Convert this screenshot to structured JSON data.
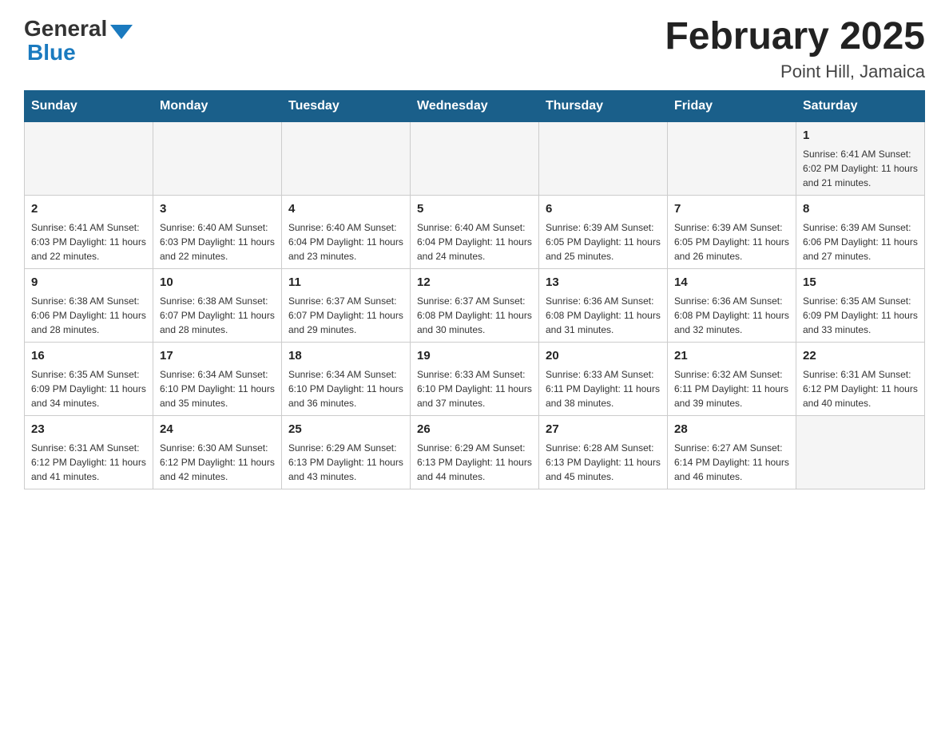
{
  "header": {
    "logo_general": "General",
    "logo_blue": "Blue",
    "month_year": "February 2025",
    "location": "Point Hill, Jamaica"
  },
  "weekdays": [
    "Sunday",
    "Monday",
    "Tuesday",
    "Wednesday",
    "Thursday",
    "Friday",
    "Saturday"
  ],
  "weeks": [
    [
      {
        "day": "",
        "info": ""
      },
      {
        "day": "",
        "info": ""
      },
      {
        "day": "",
        "info": ""
      },
      {
        "day": "",
        "info": ""
      },
      {
        "day": "",
        "info": ""
      },
      {
        "day": "",
        "info": ""
      },
      {
        "day": "1",
        "info": "Sunrise: 6:41 AM\nSunset: 6:02 PM\nDaylight: 11 hours and 21 minutes."
      }
    ],
    [
      {
        "day": "2",
        "info": "Sunrise: 6:41 AM\nSunset: 6:03 PM\nDaylight: 11 hours and 22 minutes."
      },
      {
        "day": "3",
        "info": "Sunrise: 6:40 AM\nSunset: 6:03 PM\nDaylight: 11 hours and 22 minutes."
      },
      {
        "day": "4",
        "info": "Sunrise: 6:40 AM\nSunset: 6:04 PM\nDaylight: 11 hours and 23 minutes."
      },
      {
        "day": "5",
        "info": "Sunrise: 6:40 AM\nSunset: 6:04 PM\nDaylight: 11 hours and 24 minutes."
      },
      {
        "day": "6",
        "info": "Sunrise: 6:39 AM\nSunset: 6:05 PM\nDaylight: 11 hours and 25 minutes."
      },
      {
        "day": "7",
        "info": "Sunrise: 6:39 AM\nSunset: 6:05 PM\nDaylight: 11 hours and 26 minutes."
      },
      {
        "day": "8",
        "info": "Sunrise: 6:39 AM\nSunset: 6:06 PM\nDaylight: 11 hours and 27 minutes."
      }
    ],
    [
      {
        "day": "9",
        "info": "Sunrise: 6:38 AM\nSunset: 6:06 PM\nDaylight: 11 hours and 28 minutes."
      },
      {
        "day": "10",
        "info": "Sunrise: 6:38 AM\nSunset: 6:07 PM\nDaylight: 11 hours and 28 minutes."
      },
      {
        "day": "11",
        "info": "Sunrise: 6:37 AM\nSunset: 6:07 PM\nDaylight: 11 hours and 29 minutes."
      },
      {
        "day": "12",
        "info": "Sunrise: 6:37 AM\nSunset: 6:08 PM\nDaylight: 11 hours and 30 minutes."
      },
      {
        "day": "13",
        "info": "Sunrise: 6:36 AM\nSunset: 6:08 PM\nDaylight: 11 hours and 31 minutes."
      },
      {
        "day": "14",
        "info": "Sunrise: 6:36 AM\nSunset: 6:08 PM\nDaylight: 11 hours and 32 minutes."
      },
      {
        "day": "15",
        "info": "Sunrise: 6:35 AM\nSunset: 6:09 PM\nDaylight: 11 hours and 33 minutes."
      }
    ],
    [
      {
        "day": "16",
        "info": "Sunrise: 6:35 AM\nSunset: 6:09 PM\nDaylight: 11 hours and 34 minutes."
      },
      {
        "day": "17",
        "info": "Sunrise: 6:34 AM\nSunset: 6:10 PM\nDaylight: 11 hours and 35 minutes."
      },
      {
        "day": "18",
        "info": "Sunrise: 6:34 AM\nSunset: 6:10 PM\nDaylight: 11 hours and 36 minutes."
      },
      {
        "day": "19",
        "info": "Sunrise: 6:33 AM\nSunset: 6:10 PM\nDaylight: 11 hours and 37 minutes."
      },
      {
        "day": "20",
        "info": "Sunrise: 6:33 AM\nSunset: 6:11 PM\nDaylight: 11 hours and 38 minutes."
      },
      {
        "day": "21",
        "info": "Sunrise: 6:32 AM\nSunset: 6:11 PM\nDaylight: 11 hours and 39 minutes."
      },
      {
        "day": "22",
        "info": "Sunrise: 6:31 AM\nSunset: 6:12 PM\nDaylight: 11 hours and 40 minutes."
      }
    ],
    [
      {
        "day": "23",
        "info": "Sunrise: 6:31 AM\nSunset: 6:12 PM\nDaylight: 11 hours and 41 minutes."
      },
      {
        "day": "24",
        "info": "Sunrise: 6:30 AM\nSunset: 6:12 PM\nDaylight: 11 hours and 42 minutes."
      },
      {
        "day": "25",
        "info": "Sunrise: 6:29 AM\nSunset: 6:13 PM\nDaylight: 11 hours and 43 minutes."
      },
      {
        "day": "26",
        "info": "Sunrise: 6:29 AM\nSunset: 6:13 PM\nDaylight: 11 hours and 44 minutes."
      },
      {
        "day": "27",
        "info": "Sunrise: 6:28 AM\nSunset: 6:13 PM\nDaylight: 11 hours and 45 minutes."
      },
      {
        "day": "28",
        "info": "Sunrise: 6:27 AM\nSunset: 6:14 PM\nDaylight: 11 hours and 46 minutes."
      },
      {
        "day": "",
        "info": ""
      }
    ]
  ]
}
